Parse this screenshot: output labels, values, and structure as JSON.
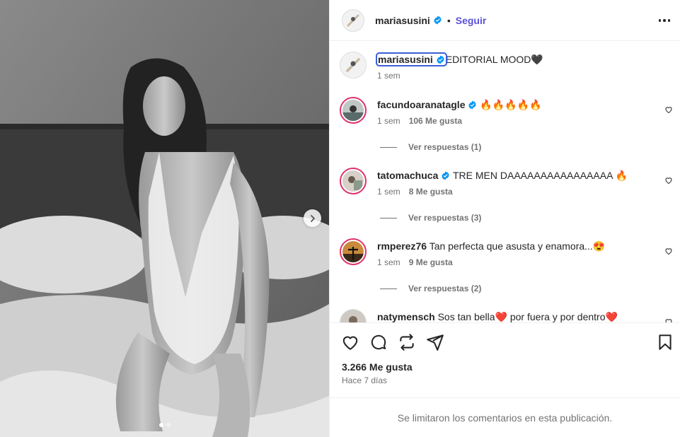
{
  "post": {
    "author": "mariasusini",
    "follow_label": "Seguir",
    "separator": "•",
    "caption_text": "EDITORIAL MOOD🖤",
    "caption_time": "1 sem",
    "likes_total": "3.266 Me gusta",
    "posted_ago": "Hace 7 días",
    "comments_limited": "Se limitaron los comentarios en esta publicación."
  },
  "comments": [
    {
      "user": "facundoaranatagle",
      "verified": true,
      "text": "🔥🔥🔥🔥🔥",
      "time": "1 sem",
      "likes": "106 Me gusta",
      "replies": "Ver respuestas (1)"
    },
    {
      "user": "tatomachuca",
      "verified": true,
      "text": "TRE MEN DAAAAAAAAAAAAAAAA 🔥",
      "time": "1 sem",
      "likes": "8 Me gusta",
      "replies": "Ver respuestas (3)"
    },
    {
      "user": "rmperez76",
      "verified": false,
      "text": "Tan perfecta que asusta y enamora...😍",
      "time": "1 sem",
      "likes": "9 Me gusta",
      "replies": "Ver respuestas (2)"
    },
    {
      "user": "natymensch",
      "verified": false,
      "text": "Sos tan bella❤️ por fuera y por dentro❤️"
    }
  ],
  "colors": {
    "accent": "#5b51d8",
    "verified": "#0095f6",
    "ring": "#e1306c"
  },
  "icons": [
    "more-icon",
    "verified-icon",
    "heart-icon",
    "comment-icon",
    "share-icon",
    "send-icon",
    "bookmark-icon",
    "chevron-right-icon"
  ]
}
